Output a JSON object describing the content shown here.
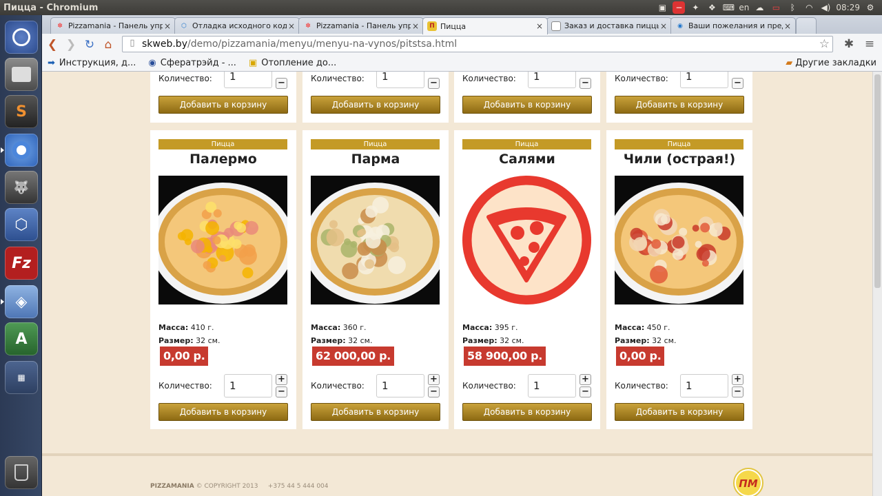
{
  "window": {
    "title": "Пицца - Chromium"
  },
  "tray": {
    "lang": "en",
    "time": "08:29"
  },
  "tabs": [
    {
      "label": "Pizzamania - Панель упра",
      "icon": "joomla-icon"
    },
    {
      "label": "Отладка исходного кода",
      "icon": "cube-icon"
    },
    {
      "label": "Pizzamania - Панель упра",
      "icon": "joomla-icon"
    },
    {
      "label": "Пицца",
      "icon": "pizzamania-icon"
    },
    {
      "label": "Заказ и доставка пиццы",
      "icon": "page-icon"
    },
    {
      "label": "Ваши пожелания и пред",
      "icon": "globe-icon"
    }
  ],
  "address": {
    "host": "skweb.by",
    "path": "/demo/pizzamania/menyu/menyu-na-vynos/pitstsa.html"
  },
  "bookmarks": [
    {
      "label": "Инструкция, д...",
      "icon": "arrow-right-icon"
    },
    {
      "label": "Сфератрэйд - ...",
      "icon": "globe-icon"
    },
    {
      "label": "Отопление до...",
      "icon": "gift-icon"
    }
  ],
  "other_bookmarks": "Другие закладки",
  "labels": {
    "quantity": "Количество:",
    "add_to_cart": "Добавить в корзину",
    "mass": "Масса:",
    "size": "Размер:",
    "plus": "+",
    "minus": "−"
  },
  "top_row": [
    {
      "qty": "1"
    },
    {
      "qty": "1"
    },
    {
      "qty": "1"
    },
    {
      "qty": "1"
    }
  ],
  "products": [
    {
      "category": "Пицца",
      "name": "Палермо",
      "mass": "410 г.",
      "size": "32 см.",
      "price": "0,00 р.",
      "qty": "1",
      "image": "photo"
    },
    {
      "category": "Пицца",
      "name": "Парма",
      "mass": "360 г.",
      "size": "32 см.",
      "price": "62 000,00 р.",
      "qty": "1",
      "image": "photo"
    },
    {
      "category": "Пицца",
      "name": "Салями",
      "mass": "395 г.",
      "size": "32 см.",
      "price": "58 900,00 р.",
      "qty": "1",
      "image": "placeholder"
    },
    {
      "category": "Пицца",
      "name": "Чили (острая!)",
      "mass": "450 г.",
      "size": "32 см.",
      "price": "0,00 р.",
      "qty": "1",
      "image": "photo"
    }
  ],
  "footer": {
    "brand": "PIZZAMANIA",
    "copyright": "© COPYRIGHT 2013",
    "phone": "+375 44 5 444 004",
    "logo_text": "ПМ"
  },
  "colors": {
    "accent": "#c49a26",
    "price": "#c73a2f",
    "page_bg": "#f3e8d6"
  }
}
